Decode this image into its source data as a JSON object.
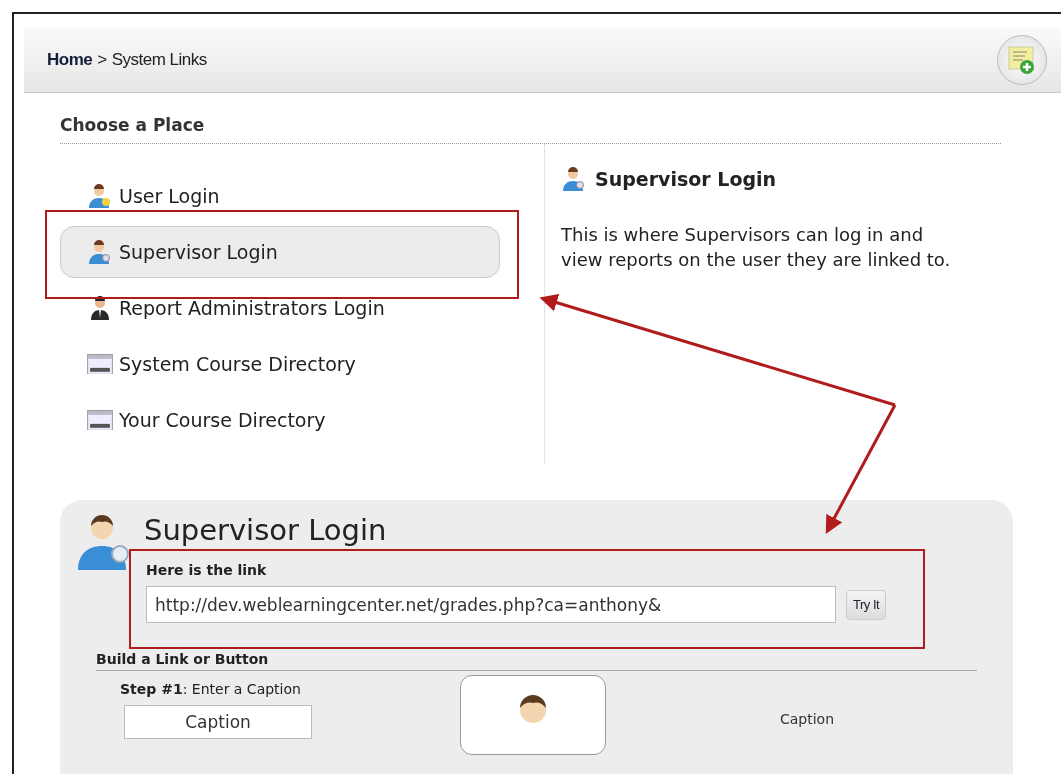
{
  "breadcrumb": {
    "home": "Home",
    "separator": ">",
    "current": "System Links"
  },
  "section_title": "Choose a Place",
  "places": [
    {
      "label": "User Login",
      "kind": "user",
      "selected": false
    },
    {
      "label": "Supervisor Login",
      "kind": "supervisor",
      "selected": true
    },
    {
      "label": "Report Administrators Login",
      "kind": "admin",
      "selected": false
    },
    {
      "label": "System Course Directory",
      "kind": "directory",
      "selected": false
    },
    {
      "label": "Your Course Directory",
      "kind": "directory",
      "selected": false
    }
  ],
  "detail": {
    "title": "Supervisor Login",
    "description": "This is where Supervisors can log in and view reports on the user they are linked to."
  },
  "link_panel": {
    "title": "Supervisor Login",
    "link_label": "Here is the link",
    "link_value": "http://dev.weblearningcenter.net/grades.php?ca=anthony&",
    "try_button": "Try It",
    "build_title": "Build a Link or Button",
    "step": "**Step #1**: Enter a Caption",
    "caption_value": "Caption",
    "preview_caption": "Caption"
  }
}
